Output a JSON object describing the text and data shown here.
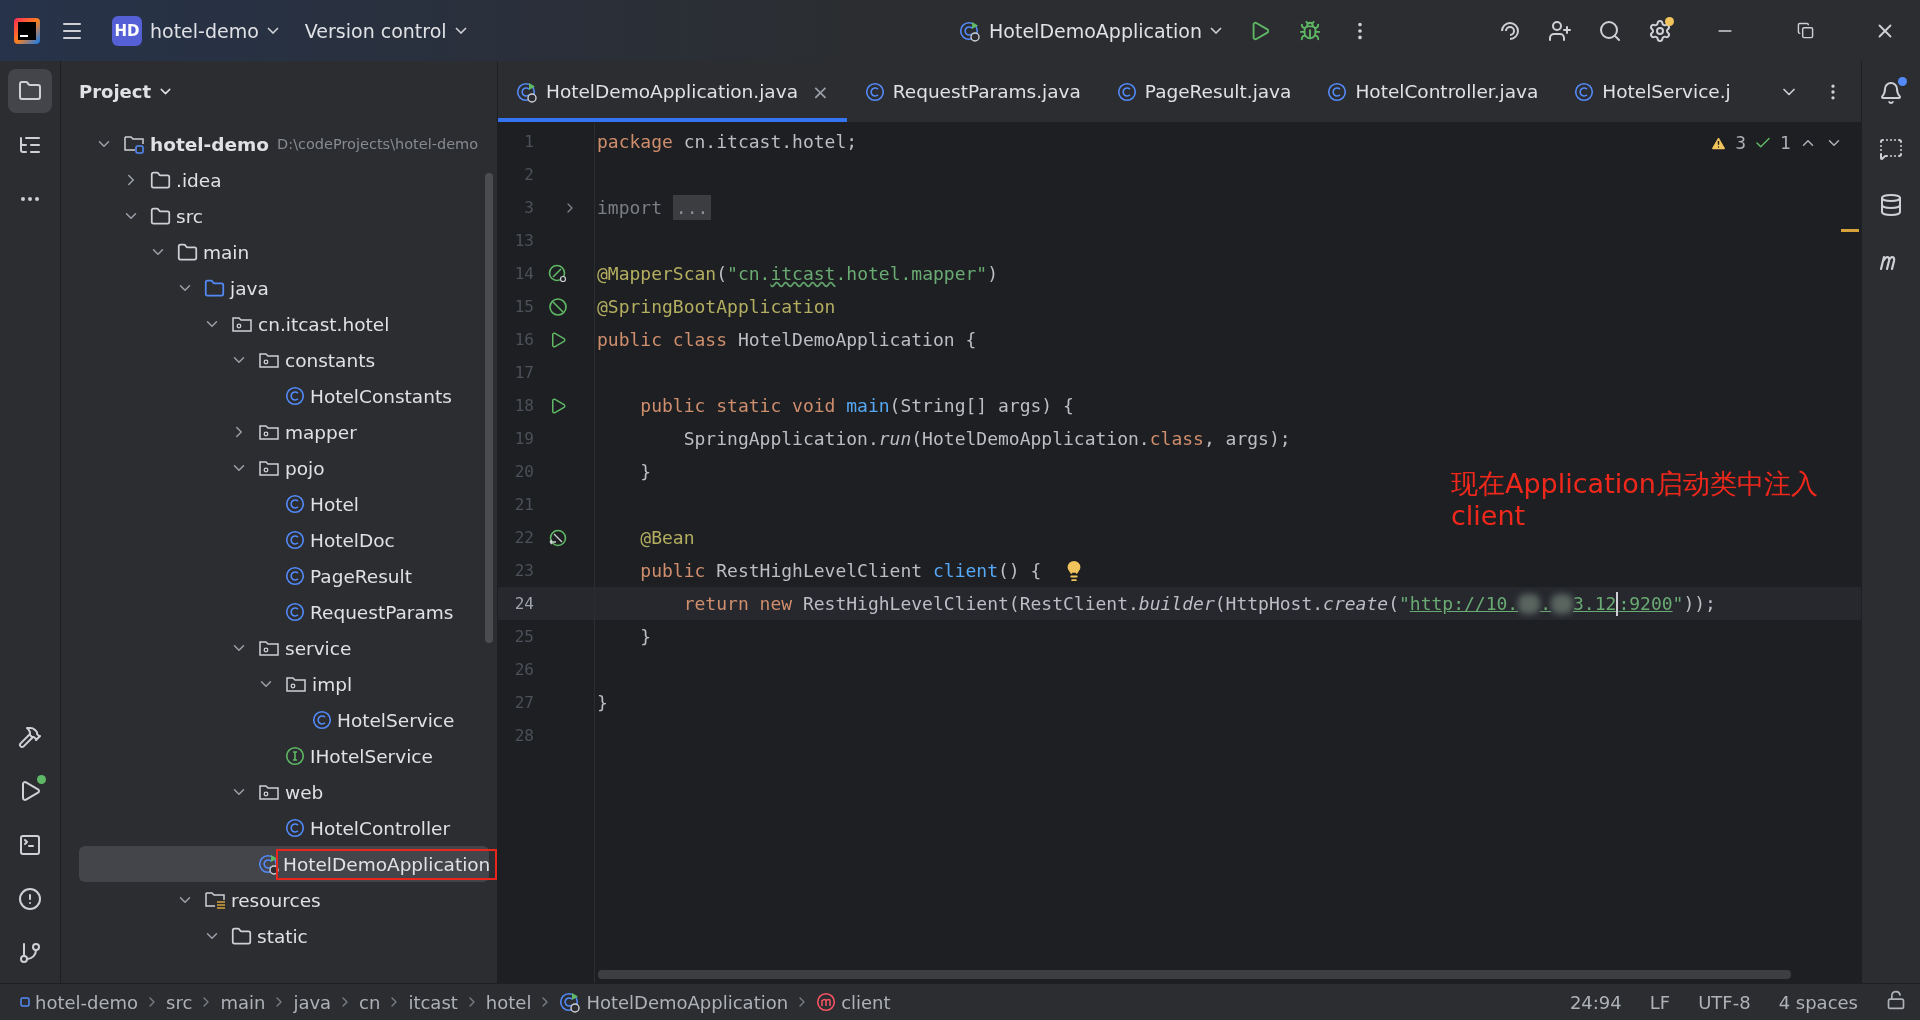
{
  "title_bar": {
    "project_badge": "HD",
    "project": "hotel-demo",
    "vcs": "Version control",
    "run_config": "HotelDemoApplication",
    "settings_badge": true
  },
  "left_toolbar": [
    {
      "selected": true
    },
    {
      "selected": false
    },
    {
      "selected": false
    }
  ],
  "left_toolbar_bottom": [
    {
      "dot": false
    },
    {
      "dot": true
    },
    {
      "dot": false
    },
    {
      "dot": false
    },
    {
      "dot": false
    }
  ],
  "project": {
    "title": "Project",
    "tree": [
      {
        "name": "hotel-demo",
        "kind": "module",
        "path": "D:\\codeProjects\\hotel-demo",
        "expanded": true,
        "selected": false,
        "children": [
          {
            "name": ".idea",
            "kind": "folder",
            "expanded": false,
            "selected": false
          },
          {
            "name": "src",
            "kind": "folder",
            "expanded": true,
            "selected": false,
            "children": [
              {
                "name": "main",
                "kind": "folder",
                "expanded": true,
                "selected": false,
                "children": [
                  {
                    "name": "java",
                    "kind": "source",
                    "expanded": true,
                    "selected": false,
                    "children": [
                      {
                        "name": "cn.itcast.hotel",
                        "kind": "package",
                        "expanded": true,
                        "selected": false,
                        "children": [
                          {
                            "name": "constants",
                            "kind": "package",
                            "expanded": true,
                            "selected": false,
                            "children": [
                              {
                                "name": "HotelConstants",
                                "kind": "class",
                                "selected": false
                              }
                            ]
                          },
                          {
                            "name": "mapper",
                            "kind": "package",
                            "expanded": false,
                            "selected": false
                          },
                          {
                            "name": "pojo",
                            "kind": "package",
                            "expanded": true,
                            "selected": false,
                            "children": [
                              {
                                "name": "Hotel",
                                "kind": "class",
                                "selected": false
                              },
                              {
                                "name": "HotelDoc",
                                "kind": "class",
                                "selected": false
                              },
                              {
                                "name": "PageResult",
                                "kind": "class",
                                "selected": false
                              },
                              {
                                "name": "RequestParams",
                                "kind": "class",
                                "selected": false
                              }
                            ]
                          },
                          {
                            "name": "service",
                            "kind": "package",
                            "expanded": true,
                            "selected": false,
                            "children": [
                              {
                                "name": "impl",
                                "kind": "package",
                                "expanded": true,
                                "selected": false,
                                "children": [
                                  {
                                    "name": "HotelService",
                                    "kind": "class",
                                    "selected": false
                                  }
                                ]
                              },
                              {
                                "name": "IHotelService",
                                "kind": "interface",
                                "selected": false
                              }
                            ]
                          },
                          {
                            "name": "web",
                            "kind": "package",
                            "expanded": true,
                            "selected": false,
                            "children": [
                              {
                                "name": "HotelController",
                                "kind": "class",
                                "selected": false
                              }
                            ]
                          },
                          {
                            "name": "HotelDemoApplication",
                            "kind": "app",
                            "selected": true,
                            "annotated": true
                          }
                        ]
                      }
                    ]
                  },
                  {
                    "name": "resources",
                    "kind": "resources",
                    "expanded": true,
                    "selected": false,
                    "children": [
                      {
                        "name": "static",
                        "kind": "folder",
                        "expanded": true,
                        "selected": false
                      }
                    ]
                  }
                ]
              }
            ]
          }
        ]
      }
    ]
  },
  "tabs": [
    {
      "label": "HotelDemoApplication.java",
      "kind": "app",
      "selected": true,
      "close": "×"
    },
    {
      "label": "RequestParams.java",
      "kind": "class",
      "selected": false
    },
    {
      "label": "PageResult.java",
      "kind": "class",
      "selected": false
    },
    {
      "label": "HotelController.java",
      "kind": "class",
      "selected": false
    },
    {
      "label": "HotelService.j",
      "kind": "class",
      "selected": false
    }
  ],
  "inspections": {
    "warnings": "3",
    "ok": "1"
  },
  "code": [
    {
      "n": "1",
      "current": false,
      "tokens": [
        {
          "kind": "kw",
          "text": "package"
        },
        {
          "kind": "plain",
          "text": " cn.itcast.hotel;"
        }
      ]
    },
    {
      "n": "2",
      "current": false
    },
    {
      "n": "3",
      "current": false,
      "gutter": {
        "kind": "fold"
      },
      "tokens": [
        {
          "kind": "dim",
          "text": "import "
        },
        {
          "kind": "folded",
          "text": "..."
        }
      ]
    },
    {
      "n": "13",
      "current": false
    },
    {
      "n": "14",
      "current": false,
      "gutter": {
        "kind": "bean-scan"
      },
      "tokens": [
        {
          "kind": "ann",
          "text": "@MapperScan"
        },
        {
          "kind": "plain",
          "text": "("
        },
        {
          "kind": "str",
          "text": "\"cn."
        },
        {
          "kind": "typo",
          "text": "itcast"
        },
        {
          "kind": "str",
          "text": ".hotel.mapper\""
        },
        {
          "kind": "plain",
          "text": ")"
        }
      ]
    },
    {
      "n": "15",
      "current": false,
      "gutter": {
        "kind": "spring"
      },
      "tokens": [
        {
          "kind": "ann",
          "text": "@SpringBootApplication"
        }
      ]
    },
    {
      "n": "16",
      "current": false,
      "gutter": {
        "kind": "run"
      },
      "tokens": [
        {
          "kind": "kw",
          "text": "public class "
        },
        {
          "kind": "plain",
          "text": "HotelDemoApplication {"
        }
      ]
    },
    {
      "n": "17",
      "current": false
    },
    {
      "n": "18",
      "current": false,
      "gutter": {
        "kind": "run"
      },
      "tokens": [
        {
          "kind": "kw",
          "text": "    public static void "
        },
        {
          "kind": "fn",
          "text": "main"
        },
        {
          "kind": "plain",
          "text": "(String[] args) {"
        }
      ]
    },
    {
      "n": "19",
      "current": false,
      "tokens": [
        {
          "kind": "plain",
          "text": "        SpringApplication."
        },
        {
          "kind": "italic",
          "text": "run"
        },
        {
          "kind": "plain",
          "text": "(HotelDemoApplication."
        },
        {
          "kind": "kw",
          "text": "class"
        },
        {
          "kind": "plain",
          "text": ", args);"
        }
      ]
    },
    {
      "n": "20",
      "current": false,
      "tokens": [
        {
          "kind": "plain",
          "text": "    }"
        }
      ]
    },
    {
      "n": "21",
      "current": false
    },
    {
      "n": "22",
      "current": false,
      "gutter": {
        "kind": "bean"
      },
      "tokens": [
        {
          "kind": "ann",
          "text": "    @Bean"
        }
      ]
    },
    {
      "n": "23",
      "current": false,
      "tokens": [
        {
          "kind": "kw",
          "text": "    public "
        },
        {
          "kind": "plain",
          "text": "RestHighLevelClient "
        },
        {
          "kind": "fn",
          "text": "client"
        },
        {
          "kind": "plain",
          "text": "() {  "
        },
        {
          "kind": "bulb"
        }
      ]
    },
    {
      "n": "24",
      "current": true,
      "tokens": [
        {
          "kind": "kw",
          "text": "        return new "
        },
        {
          "kind": "plain",
          "text": "RestHighLevelClient(RestClient."
        },
        {
          "kind": "italic",
          "text": "builder"
        },
        {
          "kind": "plain",
          "text": "(HttpHost."
        },
        {
          "kind": "italic",
          "text": "create"
        },
        {
          "kind": "plain",
          "text": "("
        },
        {
          "kind": "str",
          "text": "\""
        },
        {
          "kind": "url",
          "text": "http://10."
        },
        {
          "kind": "redacted"
        },
        {
          "kind": "url",
          "text": "."
        },
        {
          "kind": "redacted"
        },
        {
          "kind": "url",
          "text": "3.12"
        },
        {
          "kind": "caret"
        },
        {
          "kind": "url",
          "text": ":9200"
        },
        {
          "kind": "str",
          "text": "\""
        },
        {
          "kind": "plain",
          "text": "));"
        }
      ]
    },
    {
      "n": "25",
      "current": false,
      "tokens": [
        {
          "kind": "plain",
          "text": "    }"
        }
      ]
    },
    {
      "n": "26",
      "current": false
    },
    {
      "n": "27",
      "current": false,
      "tokens": [
        {
          "kind": "plain",
          "text": "}"
        }
      ]
    },
    {
      "n": "28",
      "current": false
    }
  ],
  "annotation": "现在Application启动类中注入client",
  "right_toolbar": [
    {
      "dot": true
    },
    {
      "dot": false
    },
    {
      "dot": false
    },
    {
      "dot": false
    }
  ],
  "status_bar": {
    "breadcrumbs": [
      {
        "label": "hotel-demo",
        "kind": "module"
      },
      {
        "label": "src",
        "kind": "none"
      },
      {
        "label": "main",
        "kind": "none"
      },
      {
        "label": "java",
        "kind": "none"
      },
      {
        "label": "cn",
        "kind": "none"
      },
      {
        "label": "itcast",
        "kind": "none"
      },
      {
        "label": "hotel",
        "kind": "none"
      },
      {
        "label": "HotelDemoApplication",
        "kind": "app"
      },
      {
        "label": "client",
        "kind": "method"
      }
    ],
    "items": [
      "24:94",
      "LF",
      "UTF-8",
      "4 spaces"
    ]
  }
}
